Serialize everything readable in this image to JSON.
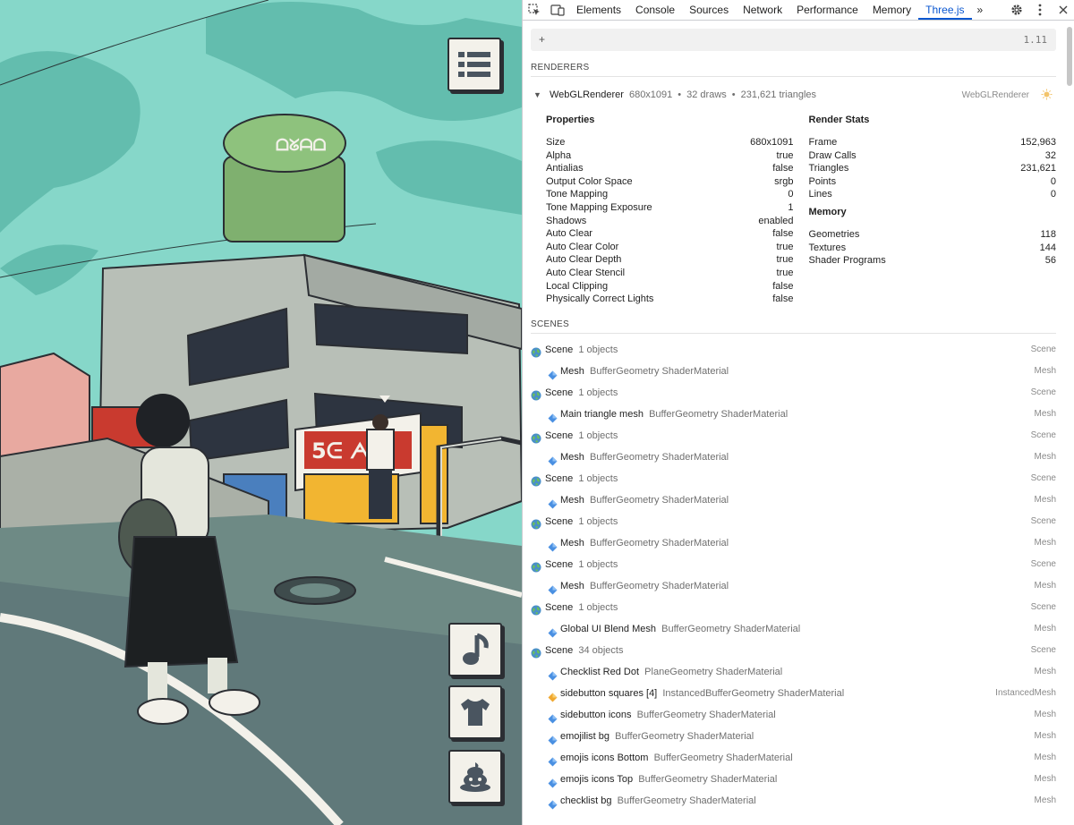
{
  "devtools": {
    "tabs": [
      {
        "label": "Elements",
        "active": false
      },
      {
        "label": "Console",
        "active": false
      },
      {
        "label": "Sources",
        "active": false
      },
      {
        "label": "Network",
        "active": false
      },
      {
        "label": "Performance",
        "active": false
      },
      {
        "label": "Memory",
        "active": false
      },
      {
        "label": "Three.js",
        "active": true
      }
    ],
    "more_tabs": "»",
    "accent_color": "#0b57d0"
  },
  "threejs": {
    "search": {
      "plus": "+",
      "version": "1.11"
    },
    "renderers_title": "RENDERERS",
    "renderer": {
      "name": "WebGLRenderer",
      "size": "680x1091",
      "draws": "32 draws",
      "triangles": "231,621 triangles",
      "type": "WebGLRenderer"
    },
    "properties": {
      "title": "Properties",
      "rows": [
        {
          "key": "Size",
          "value": "680x1091"
        },
        {
          "key": "Alpha",
          "value": "true"
        },
        {
          "key": "Antialias",
          "value": "false"
        },
        {
          "key": "Output Color Space",
          "value": "srgb"
        },
        {
          "key": "Tone Mapping",
          "value": "0"
        },
        {
          "key": "Tone Mapping Exposure",
          "value": "1"
        },
        {
          "key": "Shadows",
          "value": "enabled"
        },
        {
          "key": "Auto Clear",
          "value": "false"
        },
        {
          "key": "Auto Clear Color",
          "value": "true"
        },
        {
          "key": "Auto Clear Depth",
          "value": "true"
        },
        {
          "key": "Auto Clear Stencil",
          "value": "true"
        },
        {
          "key": "Local Clipping",
          "value": "false"
        },
        {
          "key": "Physically Correct Lights",
          "value": "false"
        }
      ]
    },
    "render_stats": {
      "title": "Render Stats",
      "rows": [
        {
          "key": "Frame",
          "value": "152,963"
        },
        {
          "key": "Draw Calls",
          "value": "32"
        },
        {
          "key": "Triangles",
          "value": "231,621"
        },
        {
          "key": "Points",
          "value": "0"
        },
        {
          "key": "Lines",
          "value": "0"
        }
      ]
    },
    "memory": {
      "title": "Memory",
      "rows": [
        {
          "key": "Geometries",
          "value": "118"
        },
        {
          "key": "Textures",
          "value": "144"
        },
        {
          "key": "Shader Programs",
          "value": "56"
        }
      ]
    },
    "scenes_title": "SCENES",
    "scenes": [
      {
        "name": "Scene",
        "count": "1 objects",
        "type": "Scene",
        "children": [
          {
            "name": "Mesh",
            "info": "BufferGeometry ShaderMaterial",
            "type": "Mesh",
            "icon": "mesh"
          }
        ]
      },
      {
        "name": "Scene",
        "count": "1 objects",
        "type": "Scene",
        "children": [
          {
            "name": "Main triangle mesh",
            "info": "BufferGeometry ShaderMaterial",
            "type": "Mesh",
            "icon": "mesh"
          }
        ]
      },
      {
        "name": "Scene",
        "count": "1 objects",
        "type": "Scene",
        "children": [
          {
            "name": "Mesh",
            "info": "BufferGeometry ShaderMaterial",
            "type": "Mesh",
            "icon": "mesh"
          }
        ]
      },
      {
        "name": "Scene",
        "count": "1 objects",
        "type": "Scene",
        "children": [
          {
            "name": "Mesh",
            "info": "BufferGeometry ShaderMaterial",
            "type": "Mesh",
            "icon": "mesh"
          }
        ]
      },
      {
        "name": "Scene",
        "count": "1 objects",
        "type": "Scene",
        "children": [
          {
            "name": "Mesh",
            "info": "BufferGeometry ShaderMaterial",
            "type": "Mesh",
            "icon": "mesh"
          }
        ]
      },
      {
        "name": "Scene",
        "count": "1 objects",
        "type": "Scene",
        "children": [
          {
            "name": "Mesh",
            "info": "BufferGeometry ShaderMaterial",
            "type": "Mesh",
            "icon": "mesh"
          }
        ]
      },
      {
        "name": "Scene",
        "count": "1 objects",
        "type": "Scene",
        "children": [
          {
            "name": "Global UI Blend Mesh",
            "info": "BufferGeometry ShaderMaterial",
            "type": "Mesh",
            "icon": "mesh"
          }
        ]
      },
      {
        "name": "Scene",
        "count": "34 objects",
        "type": "Scene",
        "children": [
          {
            "name": "Checklist Red Dot",
            "info": "PlaneGeometry ShaderMaterial",
            "type": "Mesh",
            "icon": "mesh"
          },
          {
            "name": "sidebutton squares [4]",
            "info": "InstancedBufferGeometry ShaderMaterial",
            "type": "InstancedMesh",
            "icon": "instanced"
          },
          {
            "name": "sidebutton icons",
            "info": "BufferGeometry ShaderMaterial",
            "type": "Mesh",
            "icon": "mesh"
          },
          {
            "name": "emojilist bg",
            "info": "BufferGeometry ShaderMaterial",
            "type": "Mesh",
            "icon": "mesh"
          },
          {
            "name": "emojis icons Bottom",
            "info": "BufferGeometry ShaderMaterial",
            "type": "Mesh",
            "icon": "mesh"
          },
          {
            "name": "emojis icons Top",
            "info": "BufferGeometry ShaderMaterial",
            "type": "Mesh",
            "icon": "mesh"
          },
          {
            "name": "checklist bg",
            "info": "BufferGeometry ShaderMaterial",
            "type": "Mesh",
            "icon": "mesh"
          }
        ]
      }
    ]
  },
  "game": {
    "sign_top": "ᗝᘜᗩᗝ",
    "sign_shop": "5ᕮ ᗅ",
    "buttons": [
      {
        "icon": "list-icon"
      },
      {
        "icon": "music-note-icon"
      },
      {
        "icon": "tshirt-icon"
      },
      {
        "icon": "poop-emoji-icon"
      }
    ]
  }
}
